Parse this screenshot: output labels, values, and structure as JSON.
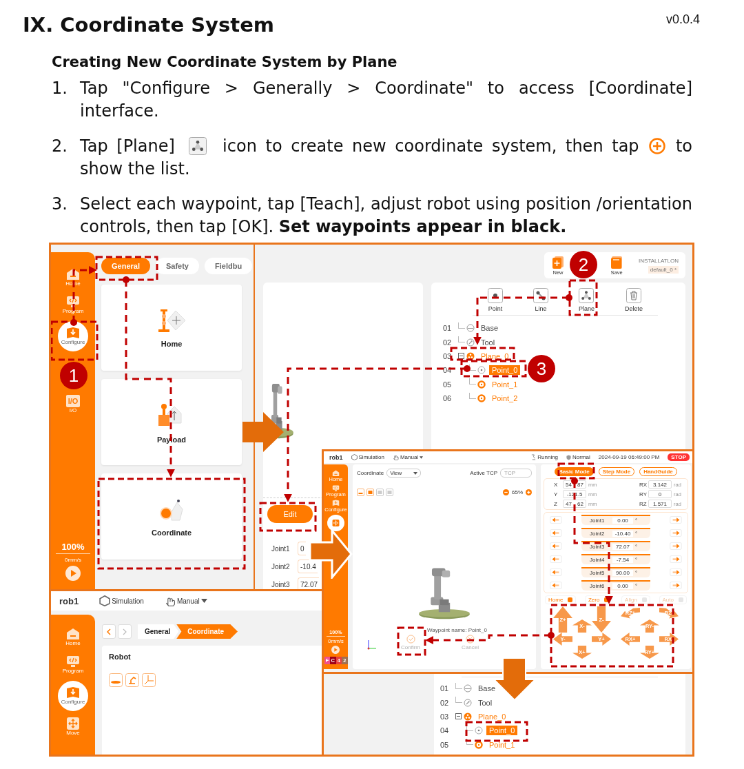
{
  "title": "IX. Coordinate System",
  "version": "v0.0.4",
  "subtitle": "Creating New Coordinate System by Plane",
  "steps": [
    {
      "number": "1.",
      "segments": [
        {
          "kind": "text",
          "text": "Tap \"Configure > Generally > Coordinate\" to access [Coordinate] interface."
        }
      ]
    },
    {
      "number": "2.",
      "segments": [
        {
          "kind": "text",
          "text": "Tap [Plane]"
        },
        {
          "kind": "plane_icon"
        },
        {
          "kind": "text",
          "text": "icon to create new coordinate system, then tap"
        },
        {
          "kind": "add_icon"
        },
        {
          "kind": "text",
          "text": "to"
        },
        {
          "kind": "text",
          "text": "show the list."
        }
      ]
    },
    {
      "number": "3.",
      "segments": [
        {
          "kind": "text",
          "text": "Select each waypoint, tap [Teach], adjust robot using position /orientation controls, then tap [OK]. **Set waypoints appear in black.**"
        }
      ]
    }
  ],
  "configure_screen": {
    "sidebar": [
      {
        "label": "Home",
        "kind": "home",
        "selected": false
      },
      {
        "label": "Program",
        "kind": "program",
        "selected": false
      },
      {
        "label": "Configure",
        "kind": "configure",
        "selected": true
      },
      {
        "label": "I/O",
        "kind": "io",
        "glyph": "I/O",
        "selected": false
      }
    ],
    "speed": "100%",
    "velocity": "0mm/s",
    "tabs": [
      {
        "label": "General",
        "selected": true
      },
      {
        "label": "Safety",
        "selected": false
      },
      {
        "label": "Fieldbu",
        "selected": false
      }
    ],
    "cards": [
      {
        "label": "Home",
        "kind": "home"
      },
      {
        "label": "Payload",
        "kind": "payload"
      },
      {
        "label": "Coordinate",
        "kind": "coordinate"
      }
    ]
  },
  "installation_screen": {
    "toolbar": [
      {
        "label": "New",
        "kind": "new"
      },
      {
        "label": "Save",
        "kind": "save"
      }
    ],
    "installation_label": "INSTALLATLON",
    "installation_name": "default_0 *",
    "edit_button": "Edit",
    "joints": [
      {
        "name": "Joint1",
        "value": "0"
      },
      {
        "name": "Joint2",
        "value": "-10.4"
      },
      {
        "name": "Joint3",
        "value": "72.07"
      }
    ],
    "tools": [
      {
        "label": "Point",
        "kind": "point"
      },
      {
        "label": "Line",
        "kind": "line"
      },
      {
        "label": "Plane",
        "kind": "plane"
      },
      {
        "label": "Delete",
        "kind": "delete"
      }
    ],
    "tree": [
      {
        "number": "01",
        "label": "Base",
        "kind": "base",
        "selected": false
      },
      {
        "number": "02",
        "label": "Tool",
        "kind": "tool",
        "selected": false
      },
      {
        "number": "03",
        "label": "Plane_0",
        "kind": "plane",
        "selected": false,
        "expanded": true,
        "children": [
          {
            "number": "04",
            "label": "Point_0",
            "kind": "point",
            "set": false,
            "selected": true
          },
          {
            "number": "05",
            "label": "Point_1",
            "kind": "point",
            "set": true,
            "selected": false
          },
          {
            "number": "06",
            "label": "Point_2",
            "kind": "point",
            "set": true,
            "selected": false
          }
        ]
      }
    ]
  },
  "move_screen": {
    "robot": "rob1",
    "mode": "Simulation",
    "control": "Manual",
    "status": "Running",
    "safety": "Normal",
    "datetime": "2024-09-19 06:49:00 PM",
    "stop": "STOP",
    "sidebar": [
      {
        "label": "Home",
        "kind": "home",
        "selected": false
      },
      {
        "label": "Program",
        "kind": "program",
        "selected": false
      },
      {
        "label": "Configure",
        "kind": "configure",
        "selected": false
      },
      {
        "kind": "move",
        "selected": true
      }
    ],
    "speed": "100%",
    "velocity": "0mm/s",
    "indicators": [
      {
        "text": "F",
        "color": "#f0508c"
      },
      {
        "text": "C",
        "color": "#a00018"
      },
      {
        "text": "4",
        "color": "#e8403c"
      },
      {
        "text": "2",
        "color": "#a07050"
      }
    ],
    "coordinate_label": "Coordinate",
    "coordinate_value": "View",
    "tcp_label": "Active TCP",
    "tcp_placeholder": "TCP",
    "zoom": "65%",
    "waypoint": "Waypoint name: Point_0",
    "actions": [
      {
        "label": "Confirm",
        "kind": "confirm"
      },
      {
        "label": "Cancel",
        "kind": "cancel"
      }
    ],
    "modes": [
      {
        "label": "Basic Mode",
        "selected": true
      },
      {
        "label": "Step Mode",
        "selected": false
      },
      {
        "label": "HandGuide",
        "selected": false
      }
    ],
    "pose": [
      {
        "axis": "X",
        "value": "54 87",
        "unit": "mm"
      },
      {
        "axis": "RX",
        "value": "3.142",
        "unit": "rad"
      },
      {
        "axis": "Y",
        "value": "-121.5",
        "unit": "mm"
      },
      {
        "axis": "RY",
        "value": "0",
        "unit": "rad"
      },
      {
        "axis": "Z",
        "value": "47 62",
        "unit": "mm"
      },
      {
        "axis": "RZ",
        "value": "1.571",
        "unit": "rad"
      }
    ],
    "joints": [
      {
        "name": "Joint1",
        "value": "0.00",
        "unit": "°"
      },
      {
        "name": "Joint2",
        "value": "-10.40",
        "unit": "°"
      },
      {
        "name": "Joint3",
        "value": "72.07",
        "unit": "°"
      },
      {
        "name": "Joint4",
        "value": "-7.54",
        "unit": "°"
      },
      {
        "name": "Joint5",
        "value": "90.00",
        "unit": "°"
      },
      {
        "name": "Joint6",
        "value": "0.00",
        "unit": "°"
      }
    ],
    "functions": [
      {
        "label": "Home",
        "disabled": false
      },
      {
        "label": "Zero",
        "disabled": false
      },
      {
        "label": "Align",
        "disabled": true
      },
      {
        "label": "Auto",
        "disabled": true
      }
    ],
    "jog": [
      {
        "label": "Z+",
        "kind": "up"
      },
      {
        "label": "Z-",
        "kind": "down"
      },
      {
        "label": "X-",
        "kind": "up"
      },
      {
        "label": "Y-",
        "kind": "left"
      },
      {
        "label": "Y+",
        "kind": "right"
      },
      {
        "label": "X+",
        "kind": "down"
      },
      {
        "label": "RZ+",
        "kind": "turn_left"
      },
      {
        "label": "RZ-",
        "kind": "turn_right"
      },
      {
        "label": "RY-",
        "kind": "up"
      },
      {
        "label": "RX+",
        "kind": "left"
      },
      {
        "label": "RX-",
        "kind": "right"
      },
      {
        "label": "RY+",
        "kind": "down"
      }
    ]
  },
  "coordinate_screen": {
    "robot": "rob1",
    "mode": "Simulation",
    "control": "Manual",
    "sidebar": [
      {
        "label": "Home",
        "kind": "home",
        "selected": false
      },
      {
        "label": "Program",
        "kind": "program",
        "selected": false
      },
      {
        "label": "Configure",
        "kind": "configure",
        "selected": true
      },
      {
        "label": "Move",
        "kind": "move",
        "selected": false
      }
    ],
    "breadcrumb": [
      {
        "label": "General",
        "selected": false
      },
      {
        "label": "Coordinate",
        "selected": true
      }
    ],
    "card_title": "Robot",
    "tree": [
      {
        "number": "01",
        "label": "Base",
        "kind": "base",
        "selected": false
      },
      {
        "number": "02",
        "label": "Tool",
        "kind": "tool",
        "selected": false
      },
      {
        "number": "03",
        "label": "Plane_0",
        "kind": "plane",
        "selected": false,
        "expanded": true,
        "children": [
          {
            "number": "04",
            "label": "Point_0",
            "kind": "point",
            "set": false,
            "selected": true
          },
          {
            "number": "05",
            "label": "Point_1",
            "kind": "point",
            "set": true,
            "selected": false
          }
        ]
      }
    ]
  },
  "callouts": [
    "1",
    "2",
    "3"
  ]
}
